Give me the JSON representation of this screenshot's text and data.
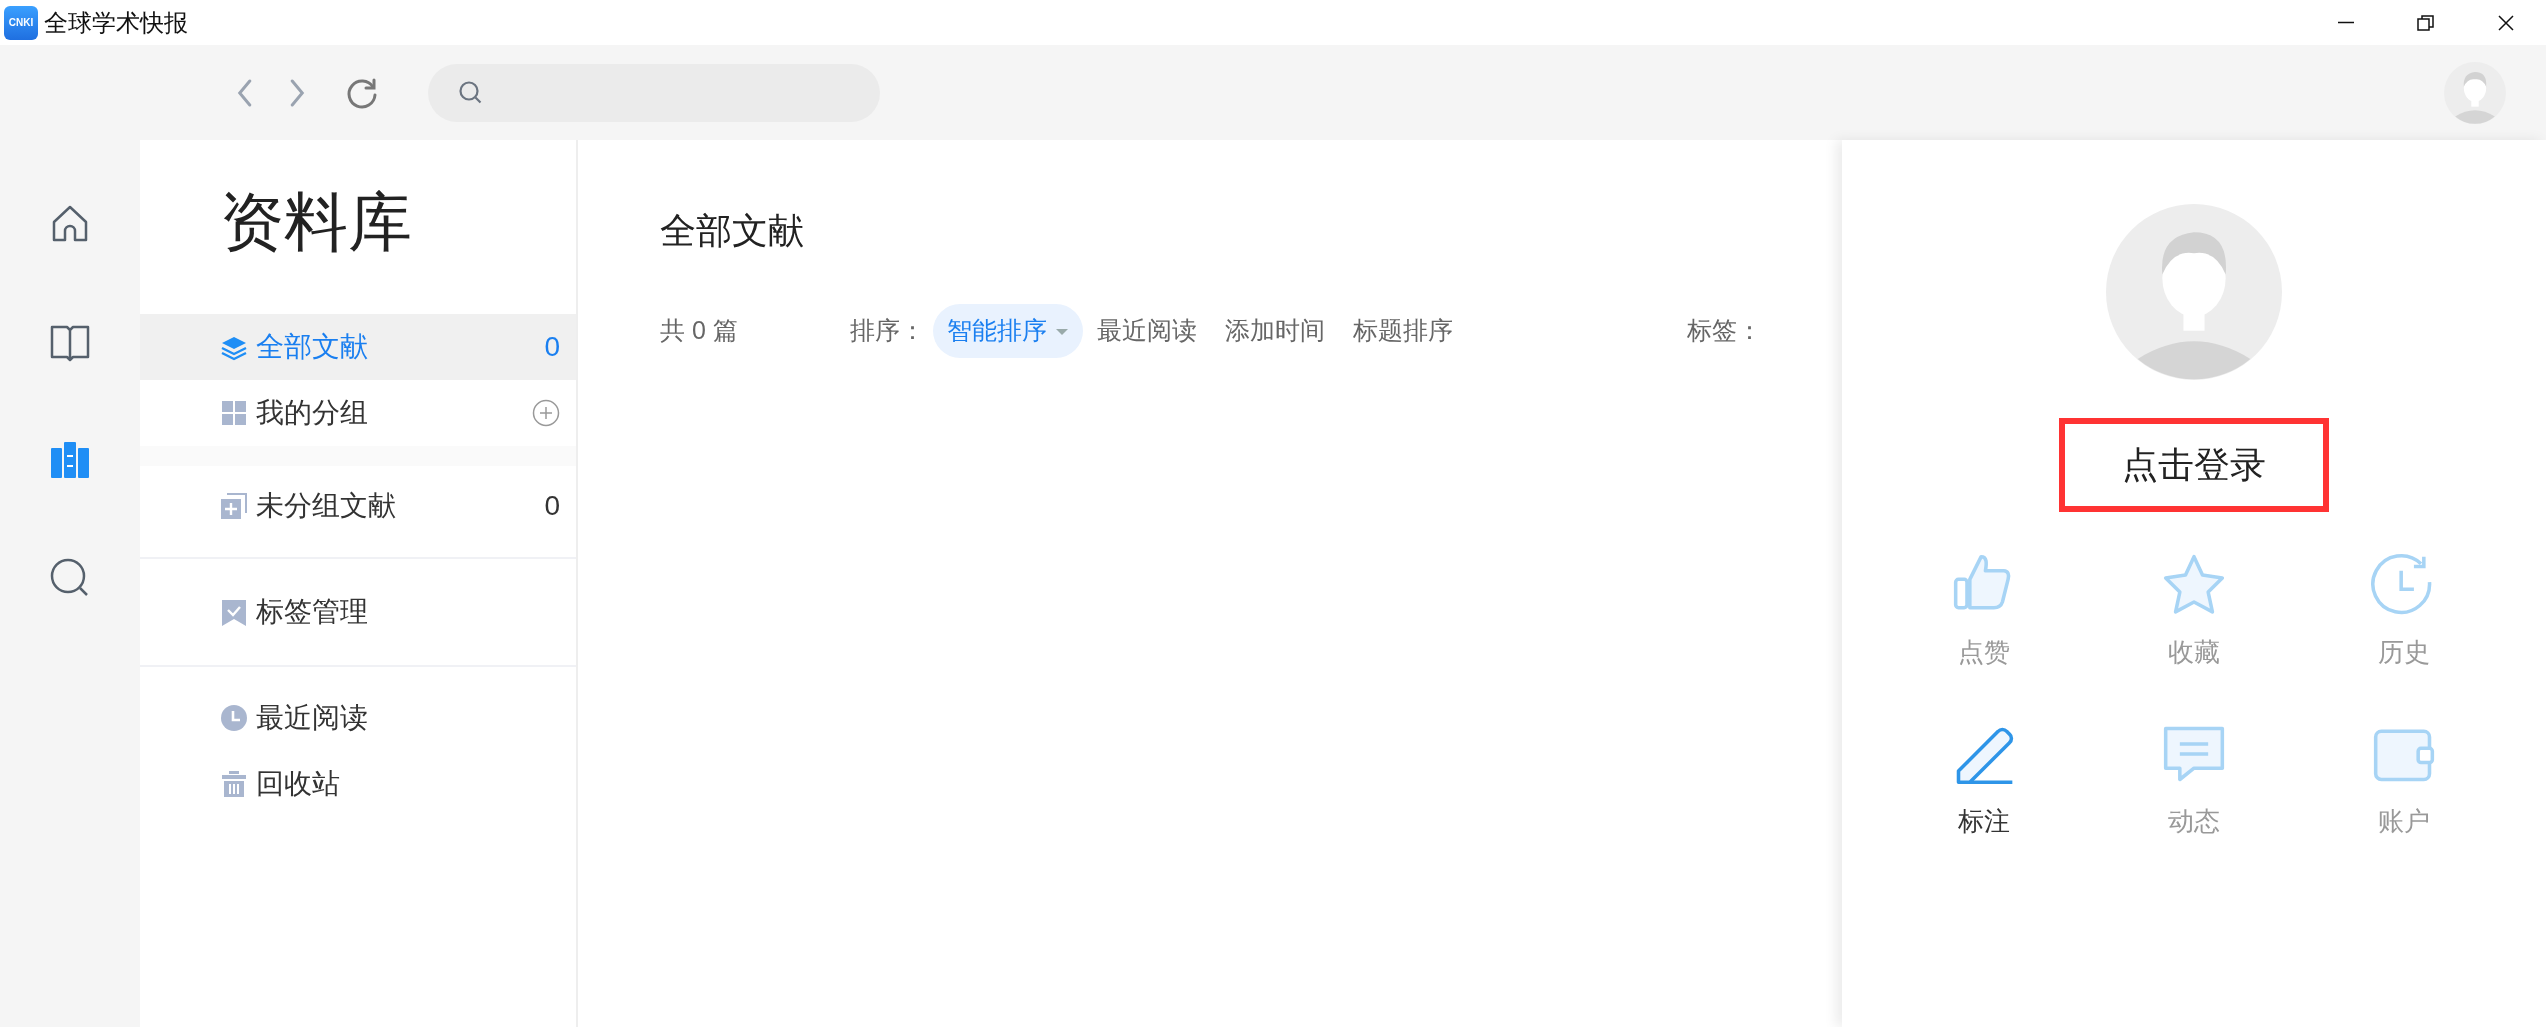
{
  "window": {
    "title": "全球学术快报",
    "logo_text": "CNKI"
  },
  "rail": [
    {
      "kind": "home",
      "selected": false
    },
    {
      "kind": "book",
      "selected": false
    },
    {
      "kind": "library",
      "selected": true
    },
    {
      "kind": "search",
      "selected": false
    }
  ],
  "library": {
    "title": "资料库",
    "sections": [
      {
        "items": [
          {
            "kind": "all",
            "label": "全部文献",
            "count": "0",
            "selected": true
          },
          {
            "kind": "groups",
            "label": "我的分组",
            "selected": false
          }
        ]
      },
      {
        "items": [
          {
            "kind": "ungrouped",
            "label": "未分组文献",
            "count": "0",
            "selected": false
          }
        ]
      },
      {
        "items": [
          {
            "kind": "tags",
            "label": "标签管理",
            "selected": false
          }
        ]
      },
      {
        "items": [
          {
            "kind": "recent",
            "label": "最近阅读",
            "selected": false
          },
          {
            "kind": "trash",
            "label": "回收站",
            "selected": false
          }
        ]
      }
    ]
  },
  "main": {
    "title": "全部文献",
    "total": "共 0 篇",
    "sort_label": "排序：",
    "sort_options": [
      {
        "label": "智能排序",
        "selected": true
      },
      {
        "label": "最近阅读",
        "selected": false
      },
      {
        "label": "添加时间",
        "selected": false
      },
      {
        "label": "标题排序",
        "selected": false
      }
    ],
    "tag_label": "标签："
  },
  "user_panel": {
    "login": "点击登录",
    "items": [
      {
        "kind": "like",
        "label": "点赞",
        "highlighted": false
      },
      {
        "kind": "star",
        "label": "收藏",
        "highlighted": false
      },
      {
        "kind": "history",
        "label": "历史",
        "highlighted": false
      },
      {
        "kind": "note",
        "label": "标注",
        "highlighted": true
      },
      {
        "kind": "feed",
        "label": "动态",
        "highlighted": false
      },
      {
        "kind": "account",
        "label": "账户",
        "highlighted": false
      }
    ]
  }
}
